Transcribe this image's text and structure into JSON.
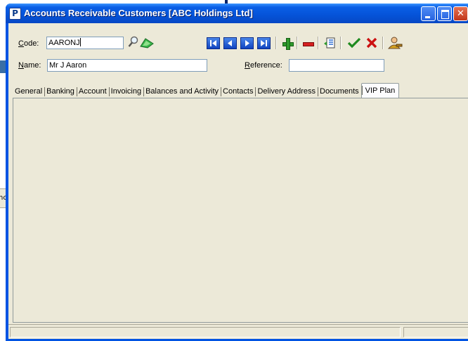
{
  "window": {
    "title": "Accounts Receivable Customers [ABC Holdings Ltd]",
    "icon": "P",
    "controls": {
      "minimize": "",
      "maximize": "",
      "close": "✕"
    }
  },
  "form": {
    "code_label_hotkey": "C",
    "code_label_rest": "ode:",
    "code_value": "AARONJ",
    "name_label_hotkey": "N",
    "name_label_rest": "ame:",
    "name_value": "Mr J Aaron",
    "reference_label_hotkey": "R",
    "reference_label_rest": "eference:",
    "reference_value": ""
  },
  "toolbar": {
    "search_icon": "magnifier-icon",
    "lookup_icon": "green-arrow-icon",
    "first": "K",
    "previous": "<",
    "next": ">",
    "last": "X",
    "add": "+",
    "delete": "−",
    "notes_icon": "list-icon",
    "save": "✔",
    "cancel": "✘",
    "contacts_icon": "user-key-icon"
  },
  "tabs": [
    {
      "label": "General"
    },
    {
      "label": "Banking"
    },
    {
      "label": "Account"
    },
    {
      "label": "Invoicing"
    },
    {
      "label": "Balances and Activity"
    },
    {
      "label": "Contacts"
    },
    {
      "label": "Delivery Address"
    },
    {
      "label": "Documents"
    },
    {
      "label": "VIP Plan",
      "active": true
    }
  ],
  "background": {
    "left_fragment_text": "nc"
  },
  "colors": {
    "titlebar": "#0553d8",
    "client": "#ece9d8",
    "nav_button": "#1044c0",
    "add": "#2f9a2c",
    "delete": "#d52020"
  }
}
